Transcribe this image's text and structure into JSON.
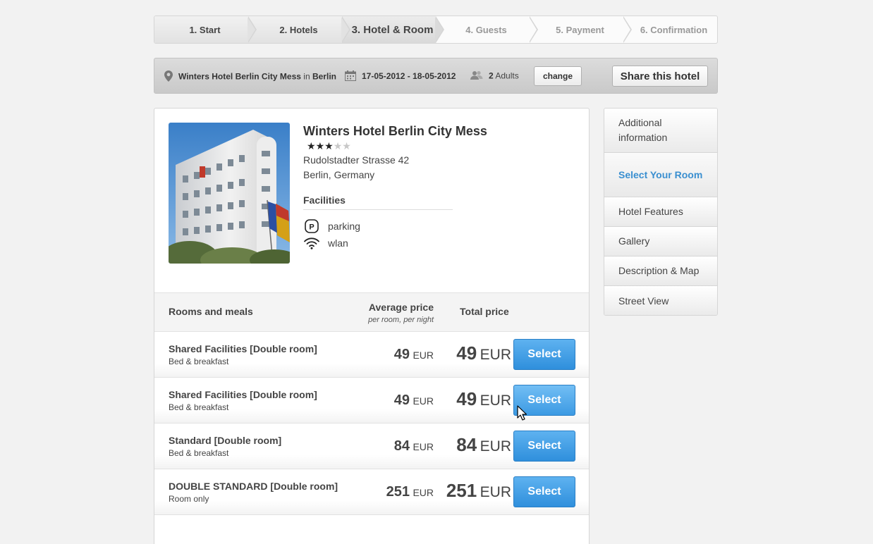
{
  "steps": [
    {
      "label": "1. Start",
      "state": "done"
    },
    {
      "label": "2. Hotels",
      "state": "done"
    },
    {
      "label": "3. Hotel & Room",
      "state": "current"
    },
    {
      "label": "4. Guests",
      "state": "pending"
    },
    {
      "label": "5. Payment",
      "state": "pending"
    },
    {
      "label": "6. Confirmation",
      "state": "pending"
    }
  ],
  "summary": {
    "hotel": "Winters Hotel Berlin City Mess",
    "in_word": "in",
    "city": "Berlin",
    "dates": "17-05-2012 - 18-05-2012",
    "guest_count": "2",
    "guest_label": "Adults",
    "change_label": "change",
    "share_label": "Share this hotel",
    "icons": {
      "location": "map-pin-icon",
      "dates": "calendar-icon",
      "guests": "users-icon"
    }
  },
  "hotel": {
    "name": "Winters Hotel Berlin City Mess",
    "stars": 3,
    "max_stars": 5,
    "address_line1": "Rudolstadter Strasse 42",
    "address_line2": "Berlin, Germany",
    "facilities_title": "Facilities",
    "facilities": [
      {
        "icon": "parking-icon",
        "label": "parking"
      },
      {
        "icon": "wifi-icon",
        "label": "wlan"
      }
    ]
  },
  "rooms": {
    "header": {
      "title": "Rooms and meals",
      "avg_price": "Average price",
      "avg_price_sub": "per room, per night",
      "total_price": "Total price"
    },
    "select_label": "Select",
    "rows": [
      {
        "name": "Shared Facilities [Double room]",
        "meal": "Bed & breakfast",
        "avg": "49",
        "avg_cur": "EUR",
        "total": "49",
        "total_cur": "EUR"
      },
      {
        "name": "Shared Facilities [Double room]",
        "meal": "Bed & breakfast",
        "avg": "49",
        "avg_cur": "EUR",
        "total": "49",
        "total_cur": "EUR"
      },
      {
        "name": "Standard [Double room]",
        "meal": "Bed & breakfast",
        "avg": "84",
        "avg_cur": "EUR",
        "total": "84",
        "total_cur": "EUR"
      },
      {
        "name": "DOUBLE STANDARD [Double room]",
        "meal": "Room only",
        "avg": "251",
        "avg_cur": "EUR",
        "total": "251",
        "total_cur": "EUR"
      }
    ]
  },
  "sidenav": [
    {
      "label": "Additional information",
      "active": false
    },
    {
      "label": "Select Your Room",
      "active": true
    },
    {
      "label": "Hotel Features",
      "active": false
    },
    {
      "label": "Gallery",
      "active": false
    },
    {
      "label": "Description & Map",
      "active": false
    },
    {
      "label": "Street View",
      "active": false
    }
  ],
  "colors": {
    "accent": "#3a8fd0",
    "select_button": "#3c9ae3",
    "background": "#f2f2f2"
  }
}
